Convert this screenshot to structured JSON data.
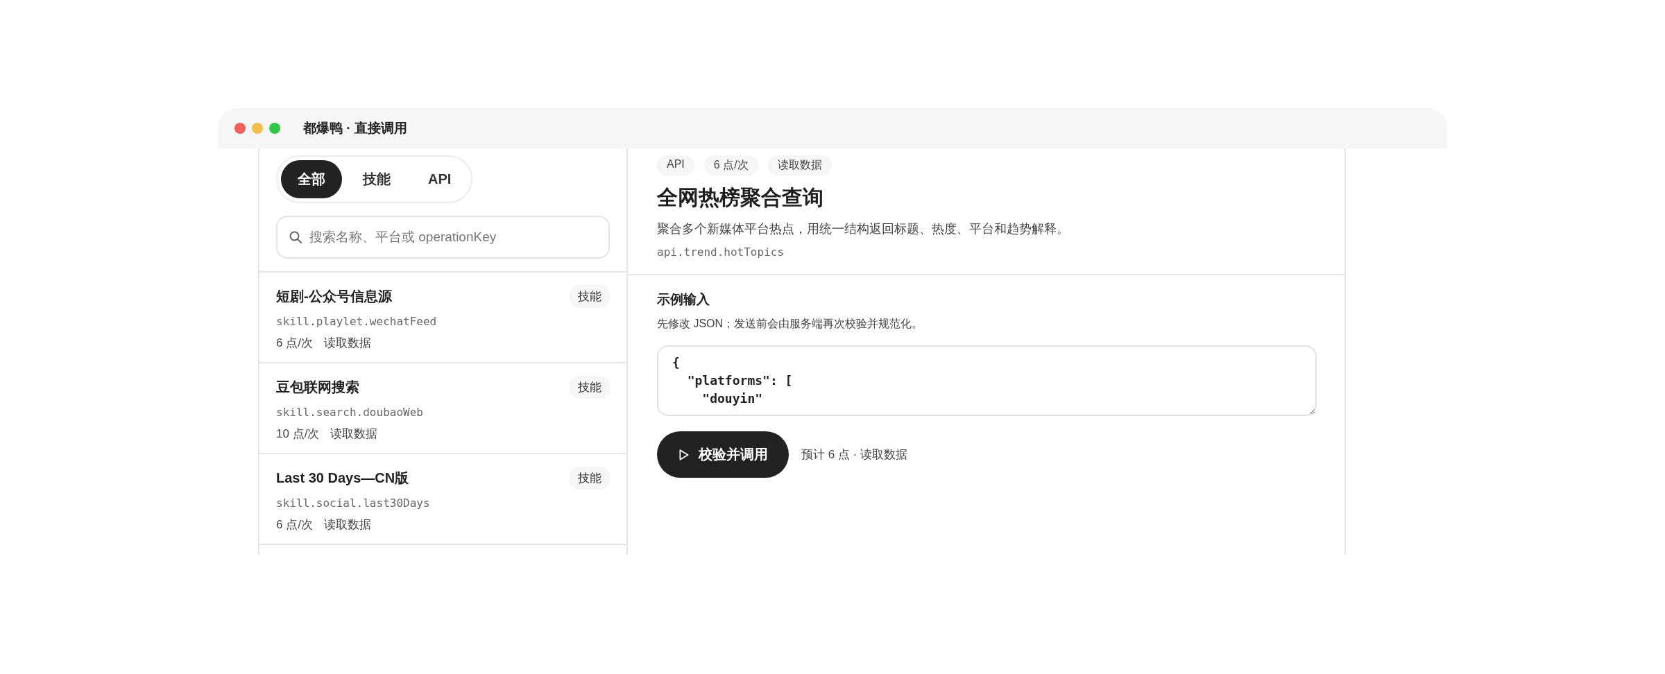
{
  "window": {
    "title": "都爆鸭 · 直接调用"
  },
  "filter_tabs": [
    {
      "label": "全部",
      "selected": true
    },
    {
      "label": "技能",
      "selected": false
    },
    {
      "label": "API",
      "selected": false
    }
  ],
  "search": {
    "placeholder": "搜索名称、平台或 operationKey"
  },
  "items": [
    {
      "name": "短剧-公众号信息源",
      "key": "skill.playlet.wechatFeed",
      "price": "6 点/次",
      "access": "读取数据",
      "tag": "技能"
    },
    {
      "name": "豆包联网搜索",
      "key": "skill.search.doubaoWeb",
      "price": "10 点/次",
      "access": "读取数据",
      "tag": "技能"
    },
    {
      "name": "Last 30 Days—CN版",
      "key": "skill.social.last30Days",
      "price": "6 点/次",
      "access": "读取数据",
      "tag": "技能"
    }
  ],
  "detail": {
    "tags": [
      "API",
      "6 点/次",
      "读取数据"
    ],
    "title": "全网热榜聚合查询",
    "description": "聚合多个新媒体平台热点，用统一结构返回标题、热度、平台和趋势解释。",
    "key": "api.trend.hotTopics"
  },
  "input": {
    "heading": "示例输入",
    "hint": "先修改 JSON；发送前会由服务端再次校验并规范化。",
    "value": "{\n  \"platforms\": [\n    \"douyin\""
  },
  "action": {
    "button": "校验并调用",
    "estimate": "预计 6 点 · 读取数据"
  }
}
